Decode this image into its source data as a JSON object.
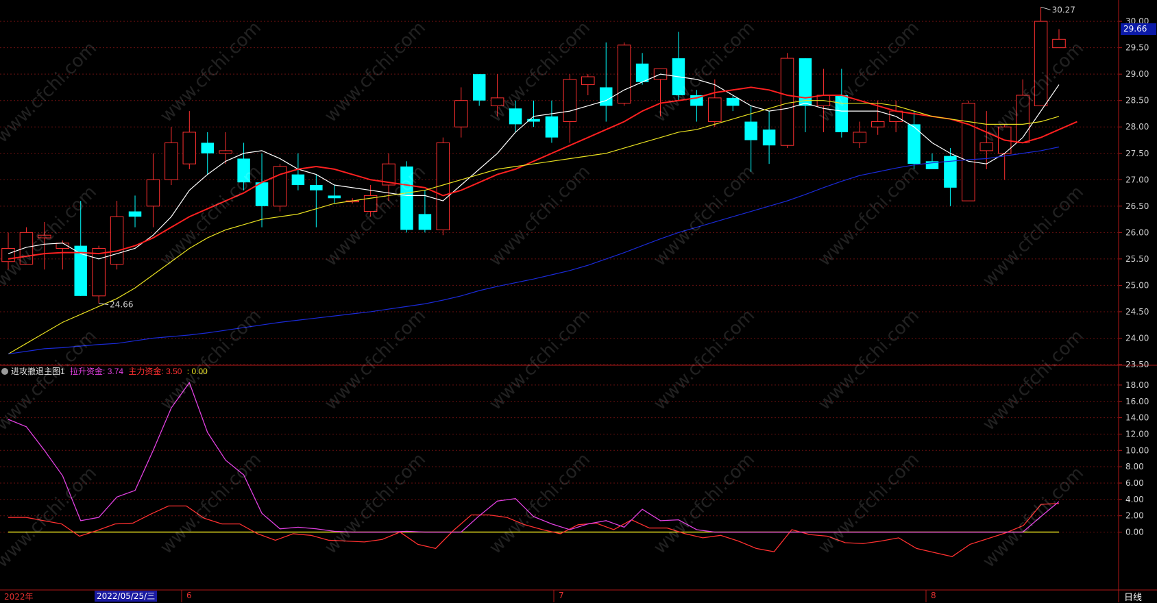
{
  "chart_data": [
    {
      "type": "candlestick",
      "title": "",
      "period_label": "日线",
      "ylim": [
        23.5,
        30.3
      ],
      "y_ticks": [
        "23.50",
        "24.00",
        "24.50",
        "25.00",
        "25.50",
        "26.00",
        "26.50",
        "27.00",
        "27.50",
        "28.00",
        "28.50",
        "29.00",
        "29.50",
        "30.00"
      ],
      "last_price": "29.66",
      "high_marker": "30.27",
      "low_marker": "24.66",
      "candles": [
        {
          "o": 25.45,
          "h": 26.0,
          "l": 25.3,
          "c": 25.7
        },
        {
          "o": 25.4,
          "h": 26.1,
          "l": 25.4,
          "c": 26.0
        },
        {
          "o": 25.9,
          "h": 26.2,
          "l": 25.3,
          "c": 25.95
        },
        {
          "o": 25.7,
          "h": 25.85,
          "l": 25.3,
          "c": 25.8
        },
        {
          "o": 25.75,
          "h": 26.6,
          "l": 24.8,
          "c": 24.8
        },
        {
          "o": 24.8,
          "h": 25.75,
          "l": 24.66,
          "c": 25.7
        },
        {
          "o": 25.4,
          "h": 26.6,
          "l": 25.3,
          "c": 26.3
        },
        {
          "o": 26.4,
          "h": 26.7,
          "l": 26.1,
          "c": 26.3
        },
        {
          "o": 26.5,
          "h": 27.5,
          "l": 26.1,
          "c": 27.0
        },
        {
          "o": 27.0,
          "h": 28.0,
          "l": 26.9,
          "c": 27.7
        },
        {
          "o": 27.3,
          "h": 28.3,
          "l": 27.2,
          "c": 27.9
        },
        {
          "o": 27.7,
          "h": 27.9,
          "l": 27.1,
          "c": 27.5
        },
        {
          "o": 27.5,
          "h": 27.9,
          "l": 27.3,
          "c": 27.55
        },
        {
          "o": 27.4,
          "h": 27.7,
          "l": 26.8,
          "c": 26.95
        },
        {
          "o": 26.95,
          "h": 27.5,
          "l": 26.1,
          "c": 26.5
        },
        {
          "o": 26.5,
          "h": 27.3,
          "l": 26.4,
          "c": 27.25
        },
        {
          "o": 27.1,
          "h": 27.5,
          "l": 26.8,
          "c": 26.9
        },
        {
          "o": 26.9,
          "h": 27.1,
          "l": 26.1,
          "c": 26.8
        },
        {
          "o": 26.7,
          "h": 26.9,
          "l": 26.55,
          "c": 26.65
        },
        {
          "o": 26.6,
          "h": 26.65,
          "l": 26.55,
          "c": 26.6
        },
        {
          "o": 26.4,
          "h": 26.9,
          "l": 26.3,
          "c": 26.7
        },
        {
          "o": 26.9,
          "h": 27.5,
          "l": 26.6,
          "c": 27.3
        },
        {
          "o": 27.25,
          "h": 27.35,
          "l": 26.0,
          "c": 26.05
        },
        {
          "o": 26.35,
          "h": 26.8,
          "l": 26.0,
          "c": 26.05
        },
        {
          "o": 26.05,
          "h": 27.8,
          "l": 25.95,
          "c": 27.7
        },
        {
          "o": 28.0,
          "h": 28.75,
          "l": 27.8,
          "c": 28.5
        },
        {
          "o": 29.0,
          "h": 29.0,
          "l": 28.4,
          "c": 28.5
        },
        {
          "o": 28.4,
          "h": 29.0,
          "l": 28.2,
          "c": 28.55
        },
        {
          "o": 28.35,
          "h": 28.5,
          "l": 27.9,
          "c": 28.05
        },
        {
          "o": 28.15,
          "h": 28.5,
          "l": 28.0,
          "c": 28.1
        },
        {
          "o": 28.2,
          "h": 28.5,
          "l": 27.7,
          "c": 27.8
        },
        {
          "o": 28.1,
          "h": 29.0,
          "l": 27.7,
          "c": 28.9
        },
        {
          "o": 28.8,
          "h": 29.0,
          "l": 28.6,
          "c": 28.95
        },
        {
          "o": 28.75,
          "h": 29.6,
          "l": 28.1,
          "c": 28.4
        },
        {
          "o": 28.45,
          "h": 29.6,
          "l": 28.4,
          "c": 29.55
        },
        {
          "o": 29.2,
          "h": 29.4,
          "l": 28.8,
          "c": 28.85
        },
        {
          "o": 28.9,
          "h": 29.0,
          "l": 28.2,
          "c": 29.1
        },
        {
          "o": 29.3,
          "h": 29.8,
          "l": 28.5,
          "c": 28.6
        },
        {
          "o": 28.6,
          "h": 28.7,
          "l": 28.1,
          "c": 28.4
        },
        {
          "o": 28.1,
          "h": 28.9,
          "l": 28.0,
          "c": 28.55
        },
        {
          "o": 28.55,
          "h": 28.6,
          "l": 28.3,
          "c": 28.4
        },
        {
          "o": 28.1,
          "h": 28.4,
          "l": 27.15,
          "c": 27.75
        },
        {
          "o": 27.95,
          "h": 28.3,
          "l": 27.3,
          "c": 27.65
        },
        {
          "o": 27.65,
          "h": 29.4,
          "l": 27.6,
          "c": 29.3
        },
        {
          "o": 29.3,
          "h": 29.3,
          "l": 27.9,
          "c": 28.4
        },
        {
          "o": 28.4,
          "h": 29.1,
          "l": 27.9,
          "c": 28.6
        },
        {
          "o": 28.6,
          "h": 29.1,
          "l": 27.8,
          "c": 27.9
        },
        {
          "o": 27.7,
          "h": 28.1,
          "l": 27.6,
          "c": 27.9
        },
        {
          "o": 28.0,
          "h": 28.5,
          "l": 27.85,
          "c": 28.1
        },
        {
          "o": 28.1,
          "h": 28.5,
          "l": 27.9,
          "c": 28.3
        },
        {
          "o": 28.05,
          "h": 28.3,
          "l": 27.2,
          "c": 27.3
        },
        {
          "o": 27.35,
          "h": 27.5,
          "l": 27.2,
          "c": 27.2
        },
        {
          "o": 27.45,
          "h": 27.6,
          "l": 26.5,
          "c": 26.85
        },
        {
          "o": 26.6,
          "h": 28.5,
          "l": 26.6,
          "c": 28.45
        },
        {
          "o": 27.55,
          "h": 28.3,
          "l": 27.2,
          "c": 27.7
        },
        {
          "o": 27.5,
          "h": 28.05,
          "l": 27.0,
          "c": 28.0
        },
        {
          "o": 27.7,
          "h": 28.9,
          "l": 27.7,
          "c": 28.6
        },
        {
          "o": 28.4,
          "h": 30.27,
          "l": 28.4,
          "c": 30.0
        },
        {
          "o": 29.5,
          "h": 29.85,
          "l": 29.55,
          "c": 29.66
        }
      ],
      "ma_lines": [
        {
          "name": "MA5",
          "color": "#ffffff",
          "values": [
            25.6,
            25.72,
            25.78,
            25.8,
            25.6,
            25.5,
            25.6,
            25.7,
            25.95,
            26.3,
            26.8,
            27.1,
            27.35,
            27.5,
            27.55,
            27.4,
            27.2,
            27.1,
            26.9,
            26.85,
            26.8,
            26.75,
            26.7,
            26.7,
            26.6,
            26.9,
            27.2,
            27.5,
            27.9,
            28.2,
            28.25,
            28.3,
            28.4,
            28.5,
            28.7,
            28.85,
            29.0,
            28.95,
            28.9,
            28.8,
            28.6,
            28.4,
            28.3,
            28.35,
            28.45,
            28.35,
            28.3,
            28.3,
            28.3,
            28.2,
            28.0,
            27.7,
            27.5,
            27.35,
            27.3,
            27.5,
            27.8,
            28.3,
            28.8
          ]
        },
        {
          "name": "MA10",
          "color": "#ff2020",
          "values": [
            25.5,
            25.55,
            25.6,
            25.62,
            25.62,
            25.6,
            25.65,
            25.75,
            25.9,
            26.1,
            26.3,
            26.45,
            26.6,
            26.75,
            26.95,
            27.1,
            27.2,
            27.25,
            27.2,
            27.1,
            27.0,
            26.95,
            26.9,
            26.85,
            26.7,
            26.8,
            26.95,
            27.1,
            27.2,
            27.35,
            27.5,
            27.65,
            27.8,
            27.95,
            28.1,
            28.3,
            28.45,
            28.5,
            28.55,
            28.65,
            28.7,
            28.75,
            28.7,
            28.6,
            28.55,
            28.6,
            28.6,
            28.5,
            28.4,
            28.3,
            28.25,
            28.2,
            28.15,
            28.05,
            27.9,
            27.75,
            27.7,
            27.8,
            27.95,
            28.1
          ]
        },
        {
          "name": "MA20",
          "color": "#e8e020",
          "values": [
            23.7,
            23.9,
            24.1,
            24.3,
            24.45,
            24.6,
            24.75,
            24.95,
            25.2,
            25.45,
            25.7,
            25.9,
            26.05,
            26.15,
            26.25,
            26.3,
            26.35,
            26.45,
            26.55,
            26.6,
            26.65,
            26.7,
            26.75,
            26.8,
            26.9,
            27.0,
            27.1,
            27.2,
            27.25,
            27.3,
            27.35,
            27.4,
            27.45,
            27.5,
            27.6,
            27.7,
            27.8,
            27.9,
            27.95,
            28.05,
            28.15,
            28.25,
            28.35,
            28.45,
            28.5,
            28.5,
            28.45,
            28.45,
            28.45,
            28.4,
            28.3,
            28.2,
            28.15,
            28.1,
            28.05,
            28.05,
            28.05,
            28.1,
            28.2
          ]
        },
        {
          "name": "MA60",
          "color": "#1a2ad8",
          "values": [
            23.7,
            23.75,
            23.8,
            23.82,
            23.85,
            23.88,
            23.9,
            23.95,
            24.0,
            24.03,
            24.06,
            24.1,
            24.15,
            24.2,
            24.25,
            24.3,
            24.34,
            24.38,
            24.42,
            24.46,
            24.5,
            24.55,
            24.6,
            24.65,
            24.72,
            24.8,
            24.9,
            24.98,
            25.05,
            25.12,
            25.2,
            25.28,
            25.38,
            25.5,
            25.62,
            25.75,
            25.88,
            26.0,
            26.1,
            26.2,
            26.3,
            26.4,
            26.5,
            26.6,
            26.72,
            26.85,
            26.97,
            27.08,
            27.15,
            27.22,
            27.28,
            27.32,
            27.35,
            27.38,
            27.4,
            27.45,
            27.5,
            27.55,
            27.62
          ]
        }
      ]
    },
    {
      "type": "line",
      "title": "进攻撤退主图1",
      "legend": [
        {
          "label": "拉升资金: 3.74",
          "color": "#e040e0"
        },
        {
          "label": "主力资金: 3.50",
          "color": "#ff3030"
        },
        {
          "label": ": 0.00",
          "color": "#e8e020"
        }
      ],
      "ylim": [
        -7.0,
        19.0
      ],
      "y_ticks": [
        "0.00",
        "2.00",
        "4.00",
        "6.00",
        "8.00",
        "10.00",
        "12.00",
        "14.00",
        "16.00",
        "18.00"
      ],
      "series": [
        {
          "name": "拉升资金",
          "color": "#e040e0",
          "values": [
            13.8,
            12.9,
            10.0,
            6.9,
            1.4,
            1.8,
            4.3,
            5.1,
            10.0,
            15.2,
            18.3,
            12.2,
            8.8,
            7.0,
            2.3,
            0.4,
            0.6,
            0.4,
            0.1,
            0.0,
            0.0,
            0.0,
            0.1,
            0.0,
            0.0,
            0.0,
            2.0,
            3.8,
            4.1,
            1.9,
            1.0,
            0.3,
            1.0,
            1.4,
            0.6,
            2.8,
            1.4,
            1.5,
            0.3,
            0.0,
            0.0,
            0.0,
            0.0,
            0.0,
            0.0,
            0.0,
            0.0,
            0.0,
            0.0,
            0.0,
            0.0,
            0.0,
            0.0,
            0.0,
            0.0,
            0.0,
            0.0,
            1.9,
            3.74
          ]
        },
        {
          "name": "主力资金",
          "color": "#ff3030",
          "values": [
            1.8,
            1.8,
            1.4,
            1.0,
            -0.5,
            0.2,
            1.0,
            1.1,
            2.2,
            3.2,
            3.2,
            1.7,
            1.0,
            1.0,
            -0.2,
            -1.0,
            -0.2,
            -0.4,
            -1.0,
            -1.1,
            -1.2,
            -0.9,
            0.0,
            -1.5,
            -2.0,
            0.2,
            2.1,
            2.1,
            1.8,
            0.9,
            0.3,
            -0.2,
            0.9,
            1.1,
            0.3,
            1.5,
            0.5,
            0.5,
            -0.2,
            -0.7,
            -0.4,
            -1.1,
            -2.0,
            -2.4,
            0.3,
            -0.3,
            -0.5,
            -1.3,
            -1.4,
            -1.1,
            -0.7,
            -2.0,
            -2.5,
            -3.0,
            -1.5,
            -0.8,
            -0.1,
            0.8,
            3.4,
            3.5
          ]
        },
        {
          "name": "",
          "color": "#e8e020",
          "values": [
            0,
            0
          ]
        }
      ]
    }
  ],
  "time_axis": {
    "year_label": "2022年",
    "cursor_date": "2022/05/25/三",
    "month_labels": [
      "6",
      "7",
      "8"
    ]
  },
  "watermark_text": "www.cfchi.com",
  "icons": {
    "indicator_toggle": "circle-chevron-icon"
  }
}
